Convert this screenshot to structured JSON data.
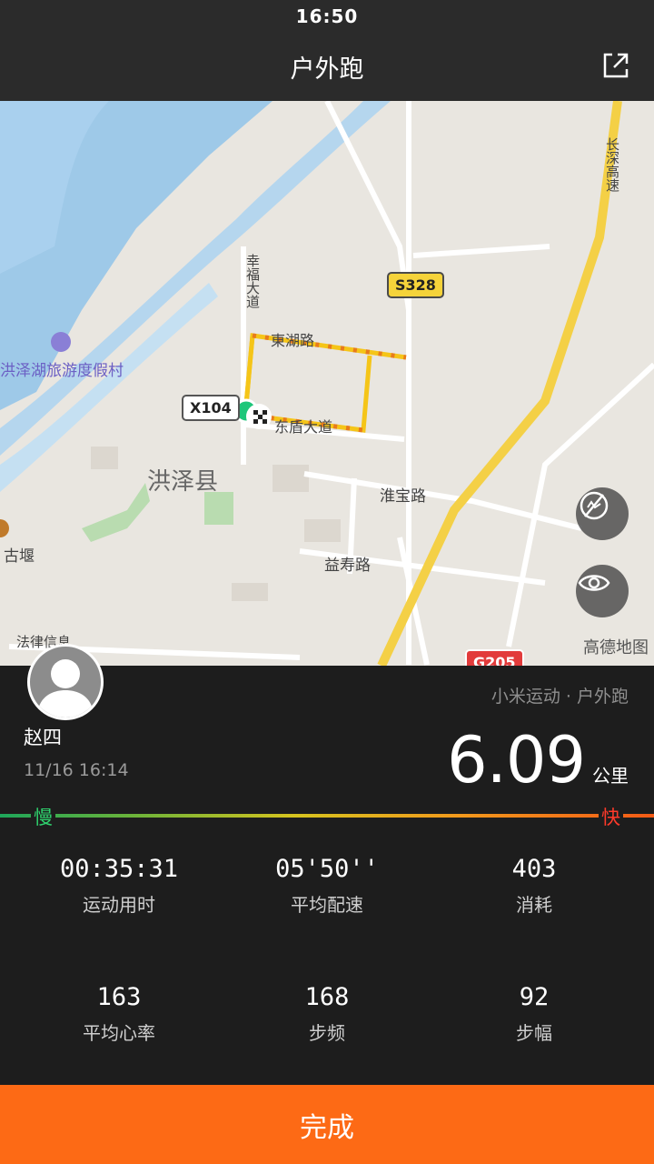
{
  "status_bar": {
    "time": "16:50"
  },
  "header": {
    "title": "户外跑",
    "share_icon": "share-icon"
  },
  "map": {
    "labels": {
      "resort": "洪泽湖旅游度假村",
      "county": "洪泽县",
      "road_xingfu": "幸福大道",
      "road_donghu": "東湖路",
      "road_dongdun": "东盾大道",
      "road_huaibao": "淮宝路",
      "road_yishou": "益寿路",
      "highway": "长深高速",
      "gudian": "古堰",
      "fajv": "法律信息"
    },
    "badges": {
      "x104": "X104",
      "s328": "S328",
      "g205": "G205"
    },
    "provider": "高德地图",
    "buttons": [
      "hide-markers-icon",
      "eye-icon"
    ]
  },
  "profile": {
    "name": "赵四",
    "datetime": "11/16 16:14",
    "source": "小米运动 · 户外跑"
  },
  "summary": {
    "distance": "6.09",
    "unit": "公里"
  },
  "pace_legend": {
    "slow": "慢",
    "fast": "快"
  },
  "stats": [
    {
      "value": "00:35:31",
      "label": "运动用时"
    },
    {
      "value": "05'50''",
      "label": "平均配速"
    },
    {
      "value": "403",
      "label": "消耗"
    },
    {
      "value": "163",
      "label": "平均心率"
    },
    {
      "value": "168",
      "label": "步频"
    },
    {
      "value": "92",
      "label": "步幅"
    }
  ],
  "action": {
    "done": "完成"
  },
  "colors": {
    "accent": "#fd6a15",
    "route": "#f5c518",
    "slow": "#2fd46e",
    "fast": "#ff3a2a"
  }
}
